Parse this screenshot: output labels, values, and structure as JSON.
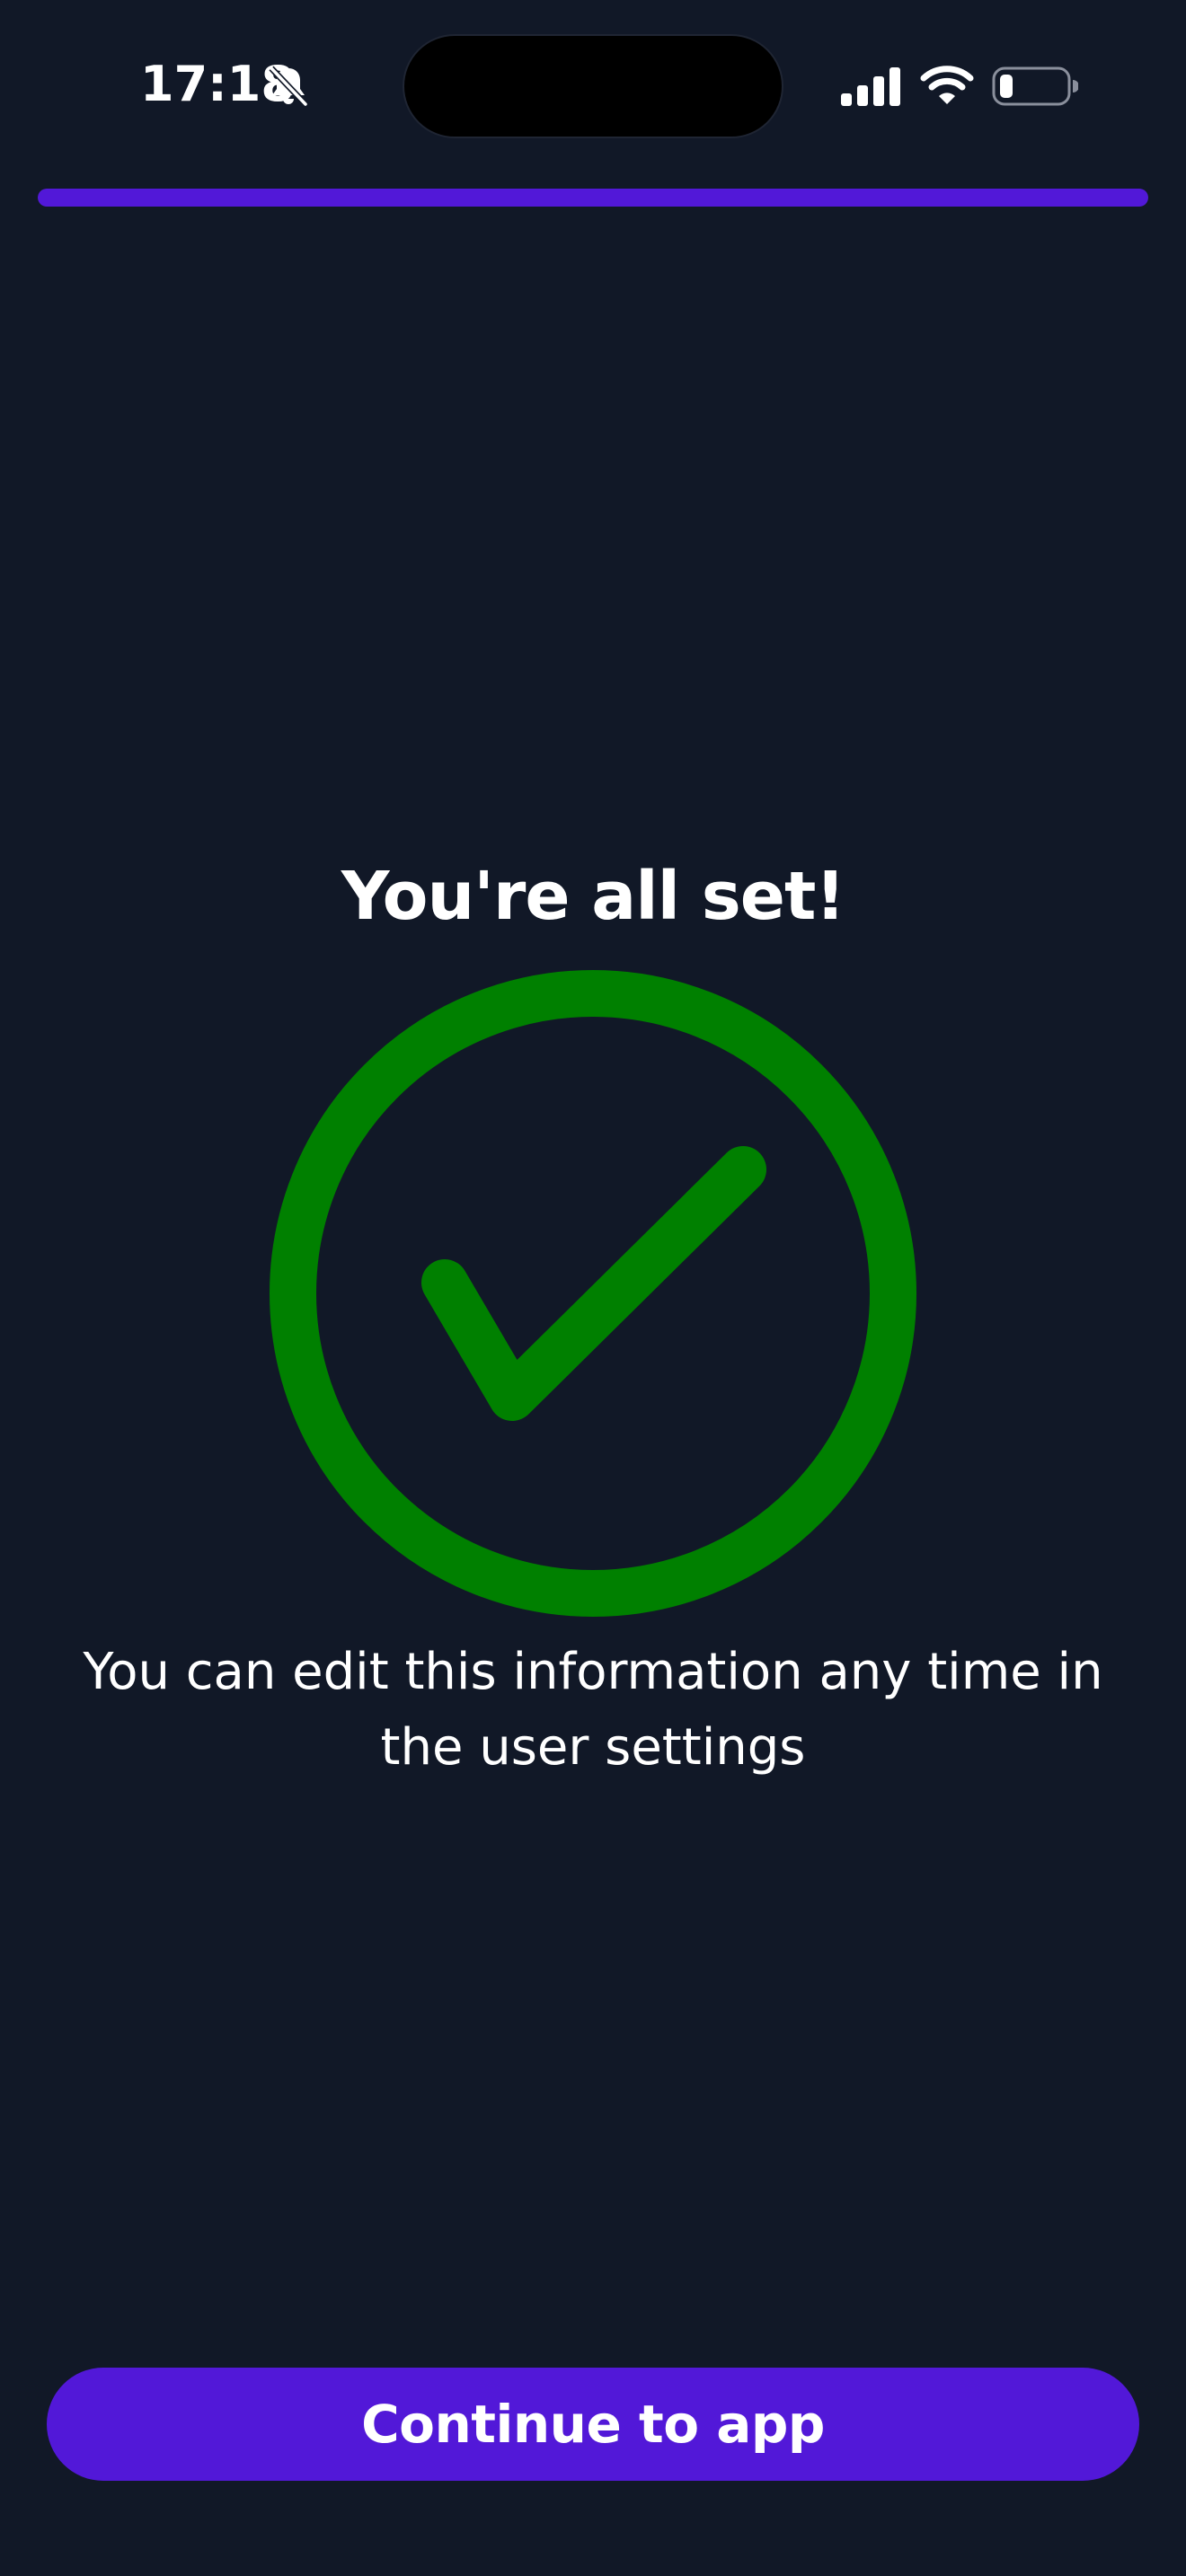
{
  "status_bar": {
    "time": "17:18",
    "icons": [
      "bell-slash-icon",
      "cellular-signal-icon",
      "wifi-icon",
      "battery-icon"
    ]
  },
  "progress": {
    "value": 1.0,
    "color": "#5218d8"
  },
  "main": {
    "title": "You're all set!",
    "success_icon": "check-circle-icon",
    "success_color": "#008000",
    "message": "You can edit this information any time in the user settings"
  },
  "footer": {
    "continue_label": "Continue to app",
    "button_color": "#5218d8"
  }
}
